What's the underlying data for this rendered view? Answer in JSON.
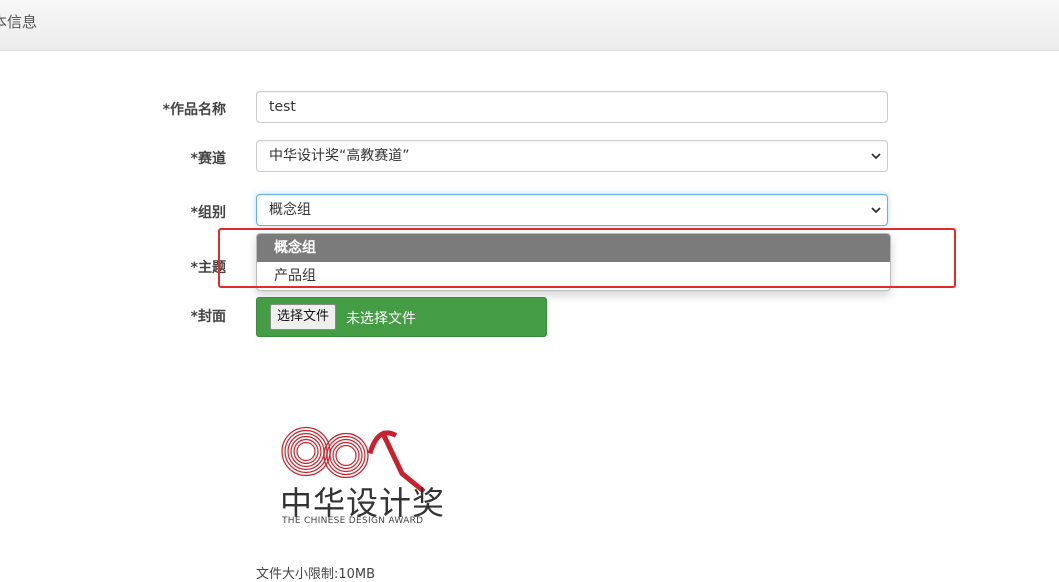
{
  "header": {
    "title": "本信息"
  },
  "form": {
    "work_name": {
      "label": "*作品名称",
      "value": "test"
    },
    "track": {
      "label": "*赛道",
      "value": "中华设计奖“高教赛道”"
    },
    "group": {
      "label": "*组别",
      "value": "概念组",
      "options": [
        "概念组",
        "产品组"
      ]
    },
    "theme": {
      "label": "*主题"
    },
    "cover": {
      "label": "*封面",
      "button_label": "选择文件",
      "status_text": "未选择文件"
    }
  },
  "logo": {
    "cn_text": "中华设计奖",
    "en_text": "THE CHINESE DESIGN AWARD"
  },
  "file_note": "文件大小限制:10MB",
  "colors": {
    "file_box": "#449d44",
    "selected_option": "#7b7b7b",
    "highlight_box": "#e12a2a",
    "logo_red": "#c8232c"
  }
}
